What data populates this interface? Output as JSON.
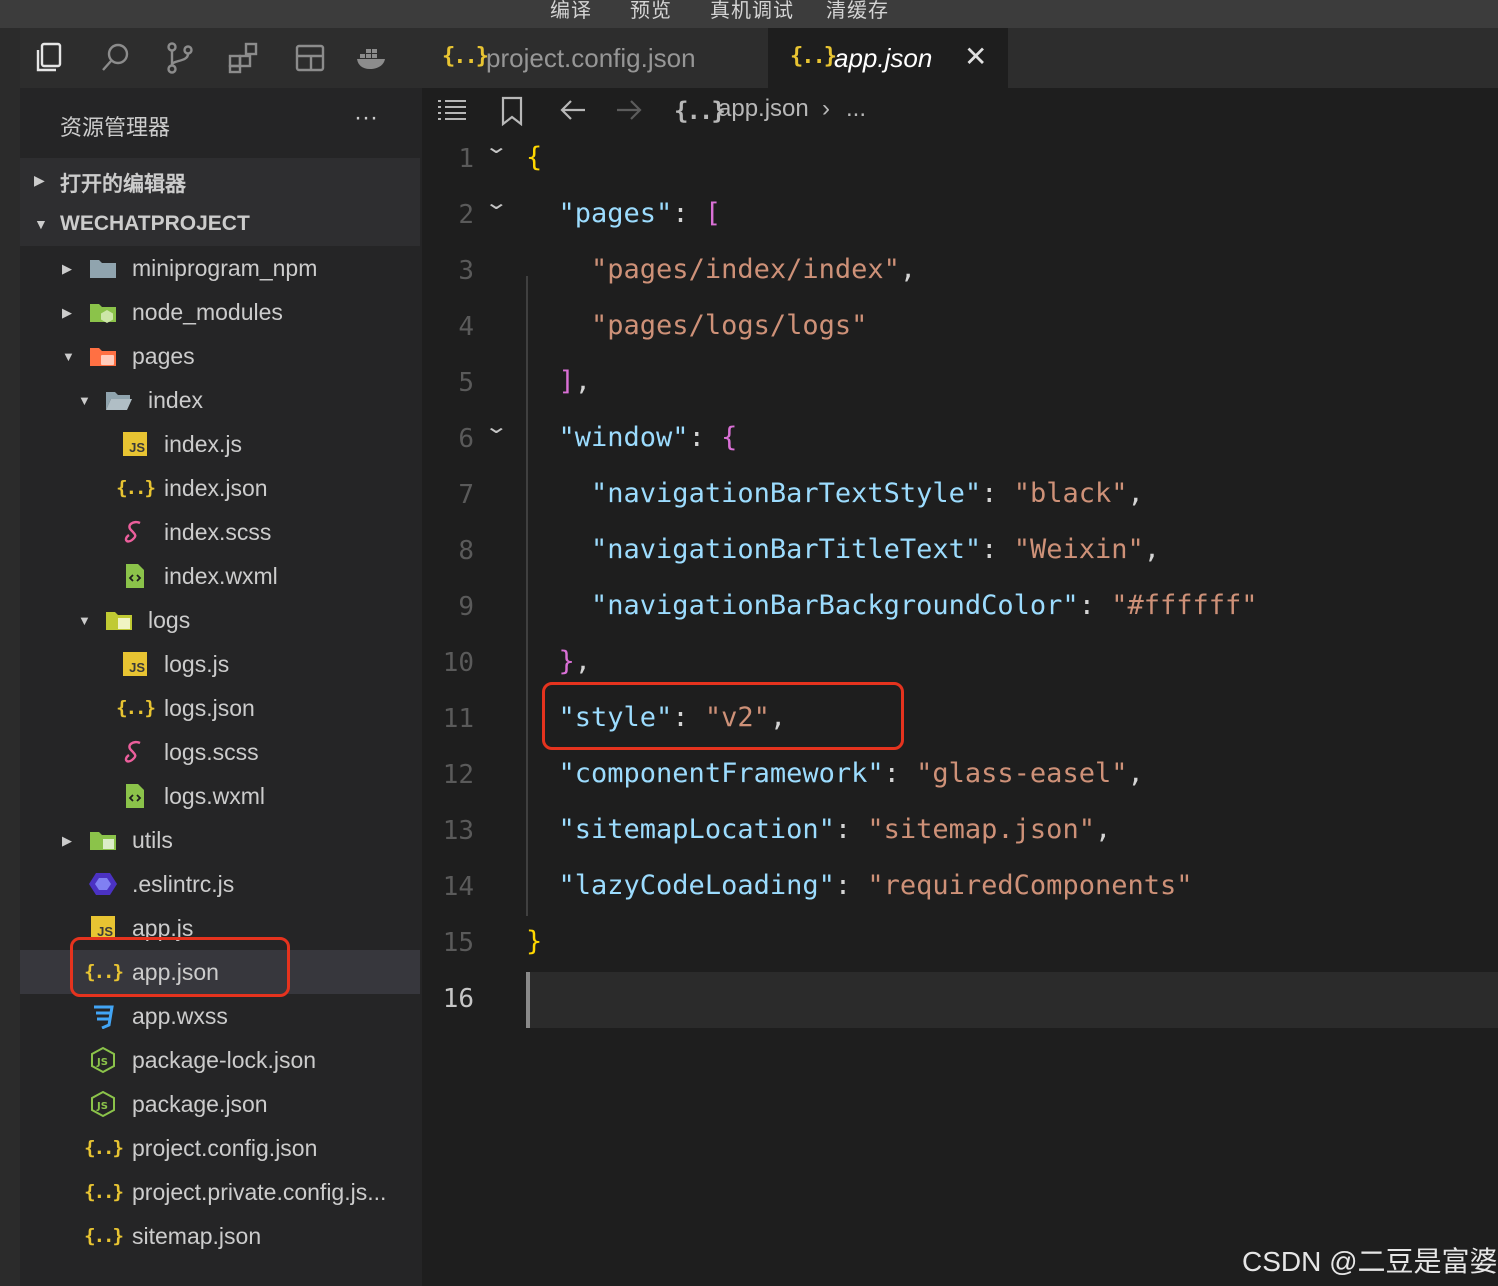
{
  "topbar": {
    "items": [
      "编译",
      "预览",
      "真机调试",
      "清缓存"
    ]
  },
  "activity_icons": [
    "files-icon",
    "search-icon",
    "source-control-icon",
    "extensions-icon",
    "layout-icon",
    "docker-icon"
  ],
  "sidebar": {
    "title": "资源管理器",
    "more": "···",
    "sections": [
      {
        "label": "打开的编辑器",
        "expanded": false
      },
      {
        "label": "WECHATPROJECT",
        "expanded": true
      }
    ],
    "tree": [
      {
        "name": "miniprogram_npm",
        "depth": 0,
        "type": "folder",
        "expanded": false,
        "icon": "folder-icon"
      },
      {
        "name": "node_modules",
        "depth": 0,
        "type": "folder",
        "expanded": false,
        "icon": "node-folder-icon"
      },
      {
        "name": "pages",
        "depth": 0,
        "type": "folder",
        "expanded": true,
        "icon": "pages-folder-icon"
      },
      {
        "name": "index",
        "depth": 1,
        "type": "folder",
        "expanded": true,
        "icon": "folder-open-icon"
      },
      {
        "name": "index.js",
        "depth": 2,
        "type": "file",
        "icon": "js-file-icon"
      },
      {
        "name": "index.json",
        "depth": 2,
        "type": "file",
        "icon": "json-file-icon"
      },
      {
        "name": "index.scss",
        "depth": 2,
        "type": "file",
        "icon": "scss-file-icon"
      },
      {
        "name": "index.wxml",
        "depth": 2,
        "type": "file",
        "icon": "wxml-file-icon"
      },
      {
        "name": "logs",
        "depth": 1,
        "type": "folder",
        "expanded": true,
        "icon": "logs-folder-icon"
      },
      {
        "name": "logs.js",
        "depth": 2,
        "type": "file",
        "icon": "js-file-icon"
      },
      {
        "name": "logs.json",
        "depth": 2,
        "type": "file",
        "icon": "json-file-icon"
      },
      {
        "name": "logs.scss",
        "depth": 2,
        "type": "file",
        "icon": "scss-file-icon"
      },
      {
        "name": "logs.wxml",
        "depth": 2,
        "type": "file",
        "icon": "wxml-file-icon"
      },
      {
        "name": "utils",
        "depth": 0,
        "type": "folder",
        "expanded": false,
        "icon": "utils-folder-icon"
      },
      {
        "name": ".eslintrc.js",
        "depth": 0,
        "type": "file",
        "icon": "eslint-file-icon"
      },
      {
        "name": "app.js",
        "depth": 0,
        "type": "file",
        "icon": "js-file-icon"
      },
      {
        "name": "app.json",
        "depth": 0,
        "type": "file",
        "icon": "json-file-icon",
        "selected": true
      },
      {
        "name": "app.wxss",
        "depth": 0,
        "type": "file",
        "icon": "css-file-icon"
      },
      {
        "name": "package-lock.json",
        "depth": 0,
        "type": "file",
        "icon": "node-file-icon"
      },
      {
        "name": "package.json",
        "depth": 0,
        "type": "file",
        "icon": "node-file-icon"
      },
      {
        "name": "project.config.json",
        "depth": 0,
        "type": "file",
        "icon": "json-file-icon"
      },
      {
        "name": "project.private.config.js...",
        "depth": 0,
        "type": "file",
        "icon": "json-file-icon"
      },
      {
        "name": "sitemap.json",
        "depth": 0,
        "type": "file",
        "icon": "json-file-icon"
      }
    ]
  },
  "tabs": [
    {
      "label": "project.config.json",
      "icon": "{..}",
      "active": false
    },
    {
      "label": "app.json",
      "icon": "{..}",
      "active": true,
      "close": "✕"
    }
  ],
  "breadcrumb": {
    "icon": "{..}",
    "file": "app.json",
    "sep": "›",
    "rest": "..."
  },
  "editor": {
    "current_line": 16,
    "lines": [
      {
        "n": 1,
        "fold": true,
        "tokens": [
          {
            "t": "{",
            "c": "b1"
          }
        ]
      },
      {
        "n": 2,
        "fold": true,
        "tokens": [
          {
            "t": "  "
          },
          {
            "t": "\"pages\"",
            "c": "k"
          },
          {
            "t": ": ",
            "c": "p"
          },
          {
            "t": "[",
            "c": "b2"
          }
        ]
      },
      {
        "n": 3,
        "fold": false,
        "tokens": [
          {
            "t": "    "
          },
          {
            "t": "\"pages/index/index\"",
            "c": "s"
          },
          {
            "t": ",",
            "c": "p"
          }
        ]
      },
      {
        "n": 4,
        "fold": false,
        "tokens": [
          {
            "t": "    "
          },
          {
            "t": "\"pages/logs/logs\"",
            "c": "s"
          }
        ]
      },
      {
        "n": 5,
        "fold": false,
        "tokens": [
          {
            "t": "  "
          },
          {
            "t": "]",
            "c": "b2"
          },
          {
            "t": ",",
            "c": "p"
          }
        ]
      },
      {
        "n": 6,
        "fold": true,
        "tokens": [
          {
            "t": "  "
          },
          {
            "t": "\"window\"",
            "c": "k"
          },
          {
            "t": ": ",
            "c": "p"
          },
          {
            "t": "{",
            "c": "b2"
          }
        ]
      },
      {
        "n": 7,
        "fold": false,
        "tokens": [
          {
            "t": "    "
          },
          {
            "t": "\"navigationBarTextStyle\"",
            "c": "k"
          },
          {
            "t": ": ",
            "c": "p"
          },
          {
            "t": "\"black\"",
            "c": "s"
          },
          {
            "t": ",",
            "c": "p"
          }
        ]
      },
      {
        "n": 8,
        "fold": false,
        "tokens": [
          {
            "t": "    "
          },
          {
            "t": "\"navigationBarTitleText\"",
            "c": "k"
          },
          {
            "t": ": ",
            "c": "p"
          },
          {
            "t": "\"Weixin\"",
            "c": "s"
          },
          {
            "t": ",",
            "c": "p"
          }
        ]
      },
      {
        "n": 9,
        "fold": false,
        "tokens": [
          {
            "t": "    "
          },
          {
            "t": "\"navigationBarBackgroundColor\"",
            "c": "k"
          },
          {
            "t": ": ",
            "c": "p"
          },
          {
            "t": "\"#ffffff\"",
            "c": "s"
          }
        ]
      },
      {
        "n": 10,
        "fold": false,
        "tokens": [
          {
            "t": "  "
          },
          {
            "t": "}",
            "c": "b2"
          },
          {
            "t": ",",
            "c": "p"
          }
        ]
      },
      {
        "n": 11,
        "fold": false,
        "tokens": [
          {
            "t": "  "
          },
          {
            "t": "\"style\"",
            "c": "k"
          },
          {
            "t": ": ",
            "c": "p"
          },
          {
            "t": "\"v2\"",
            "c": "s"
          },
          {
            "t": ",",
            "c": "p"
          }
        ]
      },
      {
        "n": 12,
        "fold": false,
        "tokens": [
          {
            "t": "  "
          },
          {
            "t": "\"componentFramework\"",
            "c": "k"
          },
          {
            "t": ": ",
            "c": "p"
          },
          {
            "t": "\"glass-easel\"",
            "c": "s"
          },
          {
            "t": ",",
            "c": "p"
          }
        ]
      },
      {
        "n": 13,
        "fold": false,
        "tokens": [
          {
            "t": "  "
          },
          {
            "t": "\"sitemapLocation\"",
            "c": "k"
          },
          {
            "t": ": ",
            "c": "p"
          },
          {
            "t": "\"sitemap.json\"",
            "c": "s"
          },
          {
            "t": ",",
            "c": "p"
          }
        ]
      },
      {
        "n": 14,
        "fold": false,
        "tokens": [
          {
            "t": "  "
          },
          {
            "t": "\"lazyCodeLoading\"",
            "c": "k"
          },
          {
            "t": ": ",
            "c": "p"
          },
          {
            "t": "\"requiredComponents\"",
            "c": "s"
          }
        ]
      },
      {
        "n": 15,
        "fold": false,
        "tokens": [
          {
            "t": "}",
            "c": "b1"
          }
        ]
      },
      {
        "n": 16,
        "fold": false,
        "tokens": []
      }
    ]
  },
  "watermark": "CSDN @二豆是富婆",
  "colors": {
    "highlight_box": "#e5331e",
    "json_key": "#9cdcfe",
    "json_string": "#ce9178",
    "bracket_gold": "#ffd700",
    "bracket_purple": "#da70d6",
    "json_icon": "#e8c432"
  }
}
